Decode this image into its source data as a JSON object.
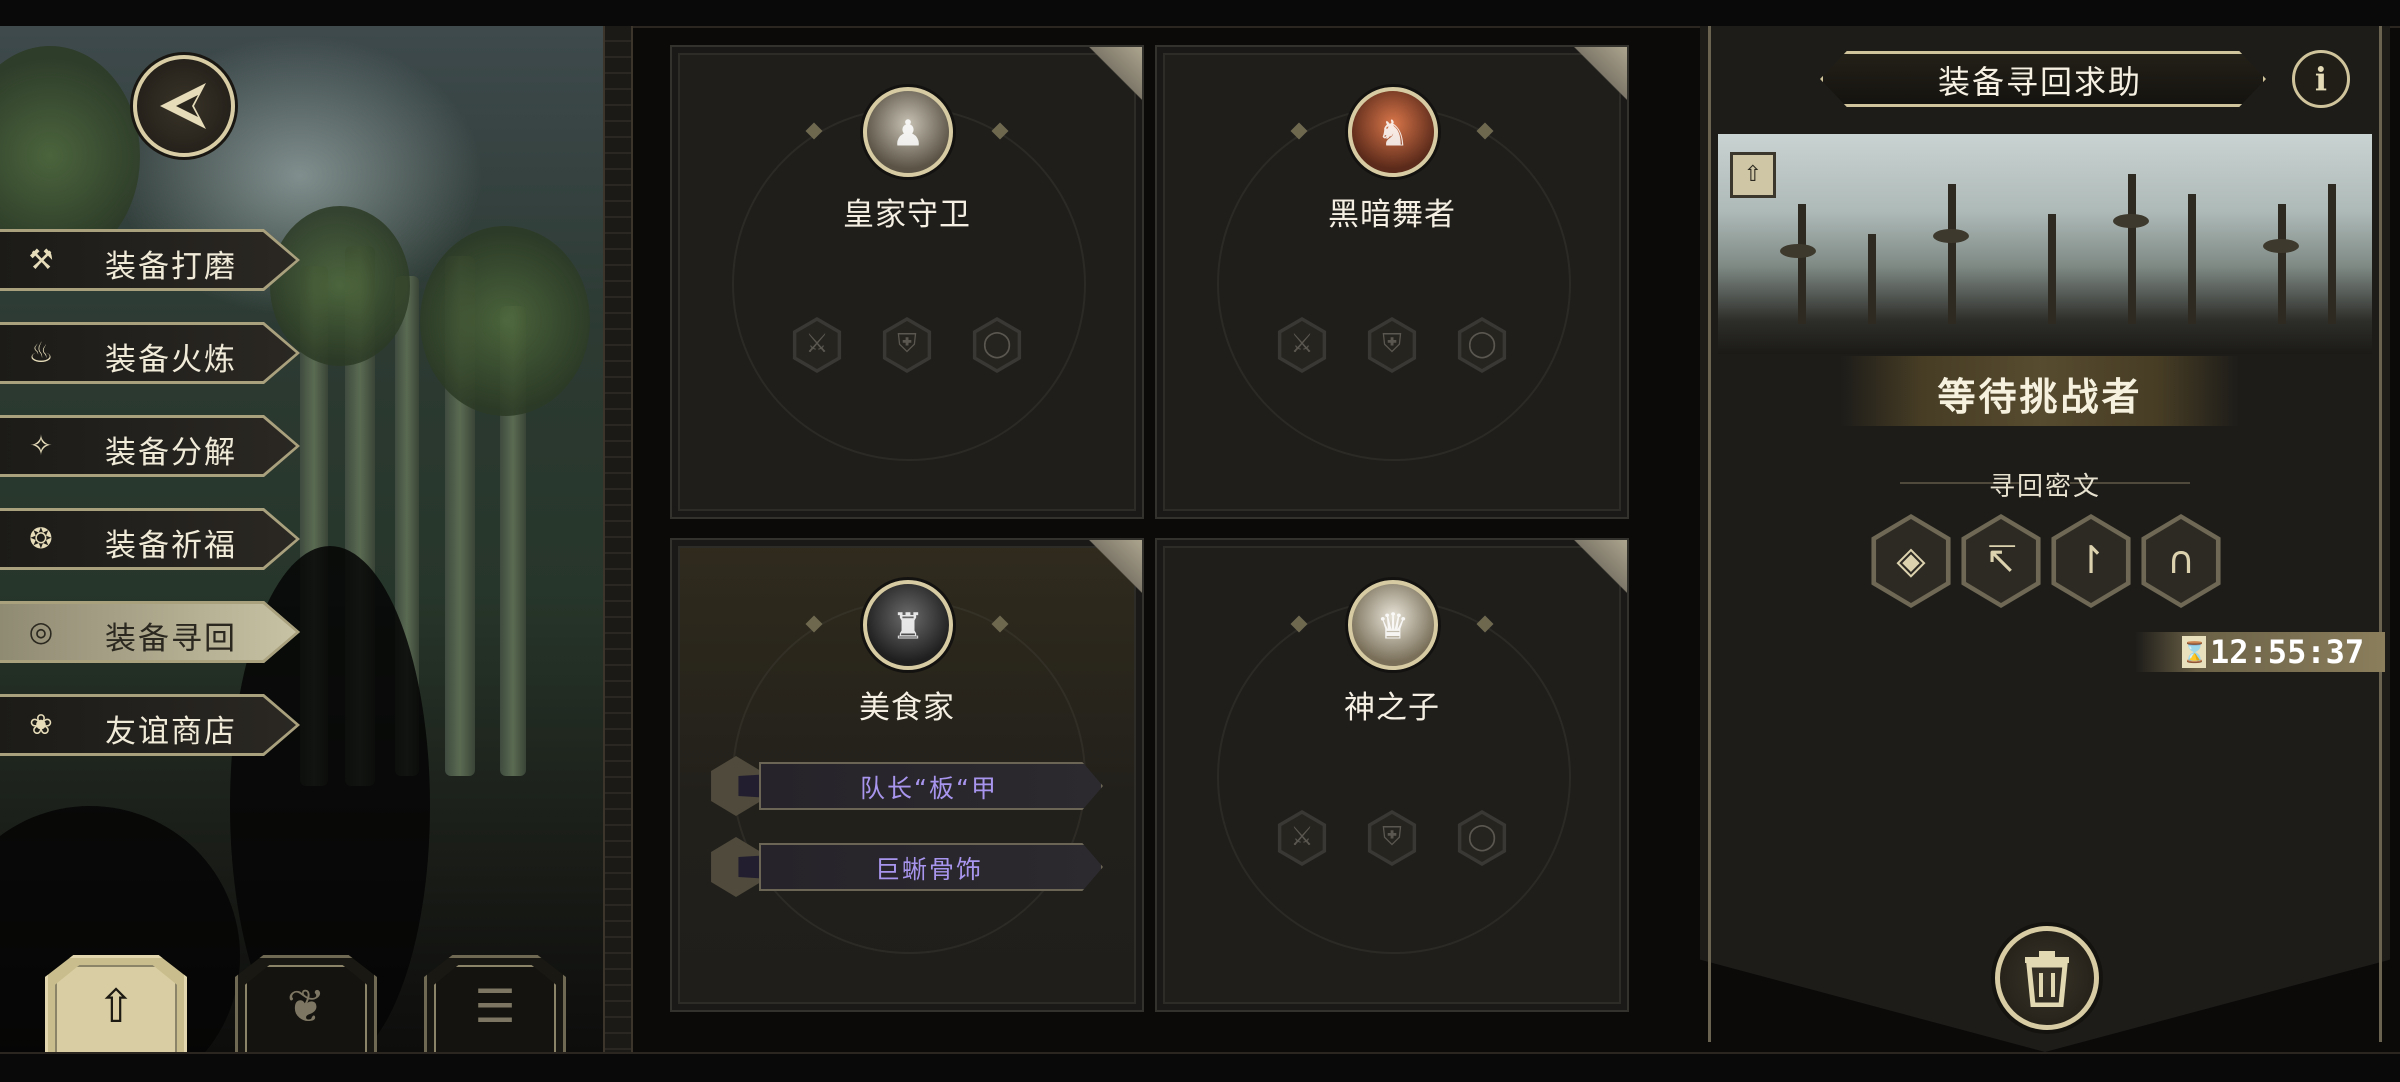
{
  "menu": {
    "items": [
      {
        "label": "装备打磨",
        "icon": "hammer-icon",
        "active": false
      },
      {
        "label": "装备火炼",
        "icon": "flame-icon",
        "active": false
      },
      {
        "label": "装备分解",
        "icon": "dismantle-icon",
        "active": false
      },
      {
        "label": "装备祈福",
        "icon": "pray-hands-icon",
        "active": false
      },
      {
        "label": "装备寻回",
        "icon": "target-icon",
        "active": true
      },
      {
        "label": "友谊商店",
        "icon": "fox-icon",
        "active": false
      }
    ]
  },
  "bottom_tabs": [
    {
      "icon": "upload-icon",
      "active": true
    },
    {
      "icon": "feather-icon",
      "active": false
    },
    {
      "icon": "list-icon",
      "active": false
    }
  ],
  "cards": [
    {
      "name": "皇家守卫",
      "portrait": "royal-guard-portrait",
      "slots": [
        "sword-slot-icon",
        "armor-slot-icon",
        "ring-slot-icon"
      ],
      "equipment": []
    },
    {
      "name": "黑暗舞者",
      "portrait": "dark-dancer-portrait",
      "slots": [
        "sword-slot-icon",
        "armor-slot-icon",
        "ring-slot-icon"
      ],
      "equipment": []
    },
    {
      "name": "美食家",
      "portrait": "gourmet-portrait",
      "slots": [],
      "equipment": [
        {
          "name": "队长“板“甲",
          "icon": "armor-icon"
        },
        {
          "name": "巨蜥骨饰",
          "icon": "ring-icon"
        }
      ]
    },
    {
      "name": "神之子",
      "portrait": "child-of-god-portrait",
      "slots": [
        "sword-slot-icon",
        "armor-slot-icon",
        "ring-slot-icon"
      ],
      "equipment": []
    }
  ],
  "right_panel": {
    "title": "装备寻回求助",
    "status": "等待挑战者",
    "section_label": "寻回密文",
    "runes": [
      "rune-1-icon",
      "rune-2-icon",
      "rune-3-icon",
      "rune-4-icon"
    ],
    "timer": "12:55:37"
  },
  "colors": {
    "accent_gold": "#cfc49b",
    "equipment_purple": "#a895ee",
    "panel_dark": "#1d1c19"
  }
}
